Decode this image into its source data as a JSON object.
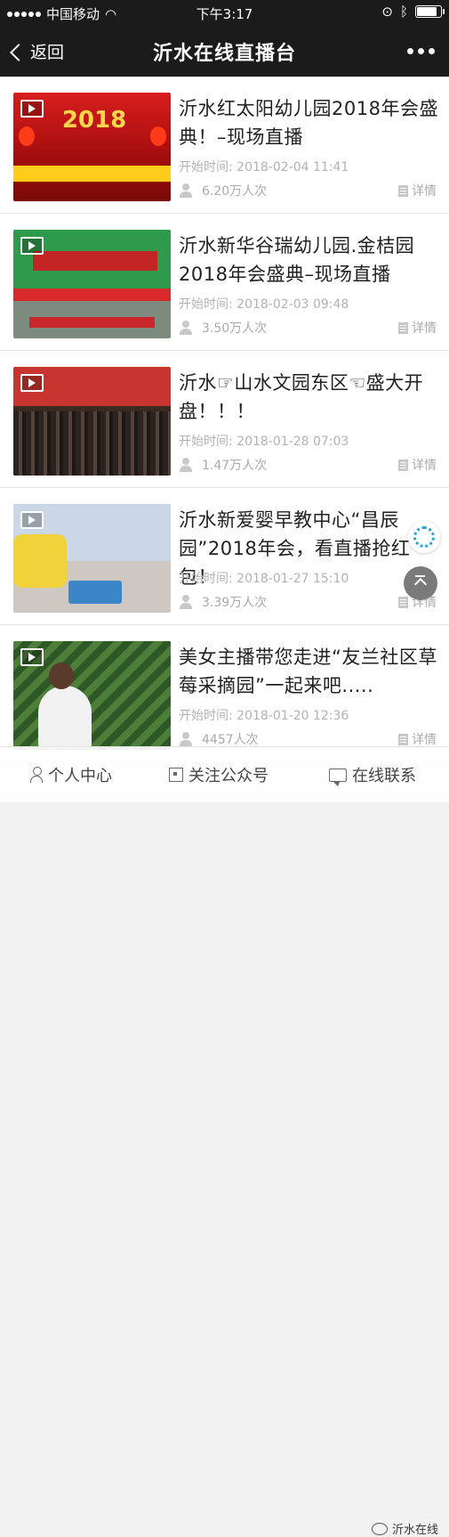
{
  "status_bar": {
    "carrier": "中国移动",
    "time": "下午3:17"
  },
  "nav": {
    "back_label": "返回",
    "title": "沂水在线直播台"
  },
  "items": [
    {
      "title": "沂水红太阳幼儿园2018年会盛典！–现场直播",
      "time_label": "开始时间: 2018-02-04 11:41",
      "viewers": "6.20万人次",
      "details": "详情",
      "thumb_text": "2018"
    },
    {
      "title": "沂水新华谷瑞幼儿园.金桔园 2018年会盛典–现场直播",
      "time_label": "开始时间: 2018-02-03 09:48",
      "viewers": "3.50万人次",
      "details": "详情"
    },
    {
      "title": "沂水☞山水文园东区☜盛大开盘！！！",
      "time_label": "开始时间: 2018-01-28 07:03",
      "viewers": "1.47万人次",
      "details": "详情"
    },
    {
      "title": "沂水新爱婴早教中心“昌辰园”2018年会，看直播抢红包！",
      "time_label": "开始时间: 2018-01-27 15:10",
      "viewers": "3.39万人次",
      "details": "详情"
    },
    {
      "title": "美女主播带您走进“友兰社区草莓采摘园”一起来吧.....",
      "time_label": "开始时间: 2018-01-20 12:36",
      "viewers": "4457人次",
      "details": "详情"
    }
  ],
  "bottom_bar": {
    "tab1": "个人中心",
    "tab2": "关注公众号",
    "tab3": "在线联系",
    "watermark": "沂水在线"
  }
}
